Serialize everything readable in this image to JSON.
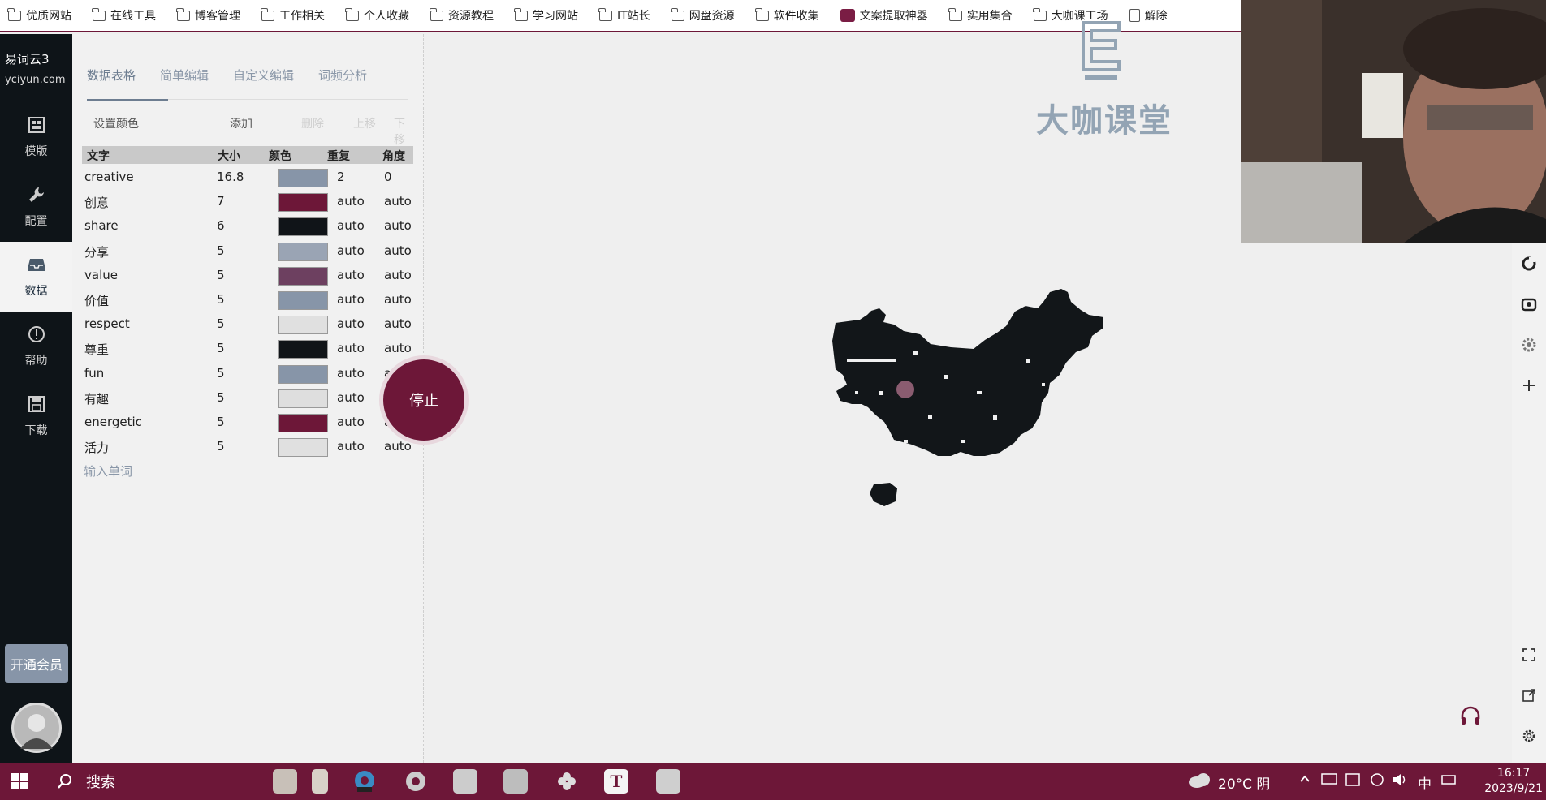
{
  "bookmarks": [
    {
      "label": "优质网站",
      "icon": "folder-icon"
    },
    {
      "label": "在线工具",
      "icon": "folder-icon"
    },
    {
      "label": "博客管理",
      "icon": "folder-icon"
    },
    {
      "label": "工作相关",
      "icon": "folder-icon"
    },
    {
      "label": "个人收藏",
      "icon": "folder-icon"
    },
    {
      "label": "资源教程",
      "icon": "folder-icon"
    },
    {
      "label": "学习网站",
      "icon": "folder-icon"
    },
    {
      "label": "IT站长",
      "icon": "folder-icon"
    },
    {
      "label": "网盘资源",
      "icon": "folder-icon"
    },
    {
      "label": "软件收集",
      "icon": "folder-icon"
    },
    {
      "label": "文案提取神器",
      "icon": "app-favicon"
    },
    {
      "label": "实用集合",
      "icon": "folder-icon"
    },
    {
      "label": "大咖课工场",
      "icon": "folder-icon"
    },
    {
      "label": "解除",
      "icon": "page-icon"
    }
  ],
  "brand": {
    "name": "易词云3",
    "domain": "yciyun.com"
  },
  "nav": [
    {
      "label": "模版",
      "icon": "template-icon"
    },
    {
      "label": "配置",
      "icon": "wrench-icon"
    },
    {
      "label": "数据",
      "icon": "inbox-icon",
      "active": true
    },
    {
      "label": "帮助",
      "icon": "help-icon"
    },
    {
      "label": "下载",
      "icon": "save-icon"
    }
  ],
  "vip_label": "开通会员",
  "tabs": [
    {
      "label": "数据表格",
      "active": true
    },
    {
      "label": "简单编辑"
    },
    {
      "label": "自定义编辑"
    },
    {
      "label": "词频分析"
    }
  ],
  "toolbar": {
    "set_color": "设置颜色",
    "add": "添加",
    "delete": "删除",
    "move_up": "上移",
    "move_down": "下移"
  },
  "table": {
    "headers": [
      "文字",
      "大小",
      "颜色",
      "重复",
      "角度"
    ],
    "rows": [
      {
        "word": "creative",
        "size": "16.8",
        "color": "#8795a8",
        "repeat": "2",
        "angle": "0"
      },
      {
        "word": "创意",
        "size": "7",
        "color": "#6d1738",
        "repeat": "auto",
        "angle": "auto"
      },
      {
        "word": "share",
        "size": "6",
        "color": "#101418",
        "repeat": "auto",
        "angle": "auto"
      },
      {
        "word": "分享",
        "size": "5",
        "color": "#9aa4b4",
        "repeat": "auto",
        "angle": "auto"
      },
      {
        "word": "value",
        "size": "5",
        "color": "#6d4060",
        "repeat": "auto",
        "angle": "auto"
      },
      {
        "word": "价值",
        "size": "5",
        "color": "#8795a8",
        "repeat": "auto",
        "angle": "auto"
      },
      {
        "word": "respect",
        "size": "5",
        "color": "#e0e0e0",
        "repeat": "auto",
        "angle": "auto"
      },
      {
        "word": "尊重",
        "size": "5",
        "color": "#101418",
        "repeat": "auto",
        "angle": "auto"
      },
      {
        "word": "fun",
        "size": "5",
        "color": "#8795a8",
        "repeat": "auto",
        "angle": "auto"
      },
      {
        "word": "有趣",
        "size": "5",
        "color": "#dedede",
        "repeat": "auto",
        "angle": "auto"
      },
      {
        "word": "energetic",
        "size": "5",
        "color": "#6d1738",
        "repeat": "auto",
        "angle": "auto"
      },
      {
        "word": "活力",
        "size": "5",
        "color": "#e0e0e0",
        "repeat": "auto",
        "angle": "auto"
      }
    ],
    "input_placeholder": "输入单词"
  },
  "stop_label": "停止",
  "watermark": {
    "text": "大咖课堂",
    "icon": "watermark-logo-icon"
  },
  "canvas": {
    "shape": "china-map-shape",
    "fill": "#121619"
  },
  "right_rail": [
    "refresh-icon",
    "camera-icon",
    "settings-icon",
    "plus-icon",
    "screenshot-icon",
    "share-icon",
    "gear-icon"
  ],
  "headset_icon": "headset-icon",
  "taskbar": {
    "search_label": "搜索",
    "weather": "20°C 阴",
    "ime": "中",
    "time": "16:17",
    "date": "2023/9/21"
  },
  "colors": {
    "accent": "#6d1738",
    "nav_bg": "#0e1418",
    "slate": "#8795a8"
  }
}
